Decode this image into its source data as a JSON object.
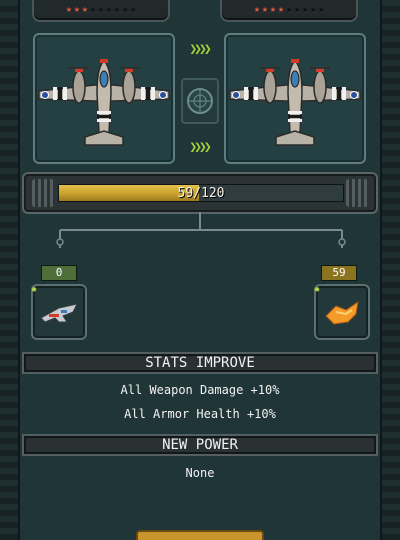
{
  "colors": {
    "star_on": "#e8583e",
    "star_off": "#0a0c0d",
    "progress_fill": "#d9b23c",
    "arrow_green": "#a5d23a"
  },
  "left_plane": {
    "stars_total": 9,
    "stars_filled": 3,
    "icon": "fighter-plane-icon"
  },
  "right_plane": {
    "stars_total": 9,
    "stars_filled": 4,
    "icon": "fighter-plane-icon"
  },
  "center_icons": [
    "chevrons-right-icon",
    "radar-icon",
    "chevrons-right-icon"
  ],
  "progress": {
    "current": 59,
    "max": 120,
    "label": "59/120"
  },
  "materials": {
    "left": {
      "count": "0",
      "icon": "jet-card-icon"
    },
    "right": {
      "count": "59",
      "icon": "orange-part-icon"
    }
  },
  "stats": {
    "header": "STATS IMPROVE",
    "lines": [
      "All Weapon Damage +10%",
      "All Armor Health +10%"
    ]
  },
  "power": {
    "header": "NEW POWER",
    "value": "None"
  }
}
